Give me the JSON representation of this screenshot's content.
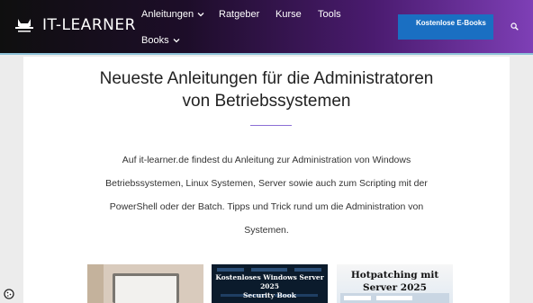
{
  "header": {
    "logo_text": "IT-LEARNER",
    "logo_icon": "cat-laptop-logo-icon",
    "nav": [
      {
        "label": "Anleitungen",
        "dropdown": true
      },
      {
        "label": "Ratgeber",
        "dropdown": false
      },
      {
        "label": "Kurse",
        "dropdown": false
      },
      {
        "label": "Tools",
        "dropdown": false
      },
      {
        "label": "Books",
        "dropdown": true
      }
    ],
    "cta_label": "Kostenlose E-Books",
    "search_icon": "search-icon",
    "colors": {
      "gradient_start": "#0f0f0f",
      "gradient_end": "#7e3fb6",
      "cta": "#1a6fc2"
    }
  },
  "main": {
    "headline_lines": [
      "Neueste Anleitungen für die Administratoren",
      "von Betriebssystemen"
    ],
    "intro_lines": [
      "Auf it-learner.de findest du Anleitung zur Administration von Windows",
      "Betriebssystemen, Linux Systemen, Server sowie auch zum Scripting mit der",
      "PowerShell oder der Batch. Tipps und Trick rund um die Administration von",
      "Systemen."
    ],
    "accent": "#8c6fd6"
  },
  "thumbnails": [
    {
      "caption_lines": []
    },
    {
      "caption_lines": [
        "Kostenloses Windows Server 2025",
        "Security Book"
      ]
    },
    {
      "caption_lines": [
        "Hotpatching mit",
        "Server 2025"
      ]
    }
  ],
  "cookie_icon": "cookie-settings-icon"
}
